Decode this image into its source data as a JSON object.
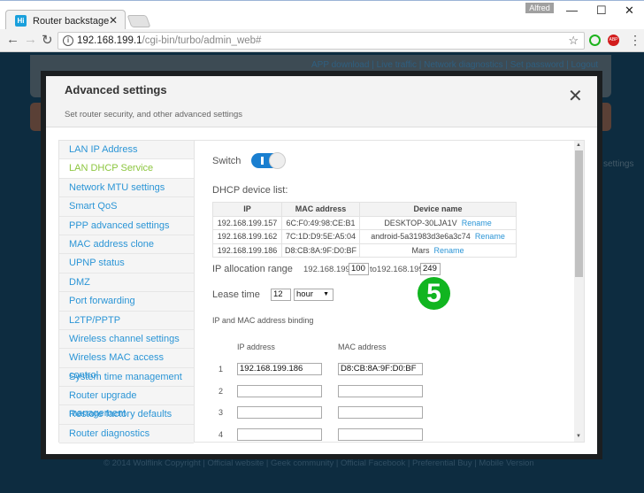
{
  "browser": {
    "tab_title": "Router backstage",
    "user": "Alfred",
    "url_host": "192.168.199.1",
    "url_path": "/cgi-bin/turbo/admin_web#"
  },
  "background": {
    "top_links": "APP download  |  Live traffic  |  Network diagnostics  |  Set password  |  Logout",
    "side_text": "settings",
    "footer": "© 2014 Wolflink Copyright  |  Official website  |  Geek community  |  Official Facebook  |  Preferential Buy  |  Mobile Version"
  },
  "modal": {
    "title": "Advanced settings",
    "subtitle": "Set router security, and other advanced settings",
    "sidebar": [
      "LAN IP Address",
      "LAN DHCP Service",
      "Network MTU settings",
      "Smart QoS",
      "PPP advanced settings",
      "MAC address clone",
      "UPNP status",
      "DMZ",
      "Port forwarding",
      "L2TP/PPTP",
      "Wireless channel settings",
      "Wireless MAC access control",
      "System time management",
      "Router upgrade management",
      "Restore factory defaults",
      "Router diagnostics"
    ],
    "active_item": "LAN DHCP Service",
    "content": {
      "switch_label": "Switch",
      "switch_on": true,
      "device_list_label": "DHCP device list:",
      "columns": [
        "IP",
        "MAC address",
        "Device name"
      ],
      "devices": [
        {
          "ip": "192.168.199.157",
          "mac": "6C:F0:49:98:CE:B1",
          "name": "DESKTOP-30LJA1V",
          "action": "Rename"
        },
        {
          "ip": "192.168.199.162",
          "mac": "7C:1D:D9:5E:A5:04",
          "name": "android-5a31983d3e6a3c74",
          "action": "Rename"
        },
        {
          "ip": "192.168.199.186",
          "mac": "D8:CB:8A:9F:D0:BF",
          "name": "Mars",
          "action": "Rename"
        }
      ],
      "range_label": "IP allocation range",
      "range_prefix": "192.168.199.",
      "range_start": "100",
      "range_to": "to192.168.199.",
      "range_end": "249",
      "lease_label": "Lease time",
      "lease_value": "12",
      "lease_unit": "hour",
      "binding_label": "IP and MAC address binding",
      "binding_ip_header": "IP address",
      "binding_mac_header": "MAC address",
      "bindings": [
        {
          "n": "1",
          "ip": "192.168.199.186",
          "mac": "D8:CB:8A:9F:D0:BF"
        },
        {
          "n": "2",
          "ip": "",
          "mac": ""
        },
        {
          "n": "3",
          "ip": "",
          "mac": ""
        },
        {
          "n": "4",
          "ip": "",
          "mac": ""
        }
      ]
    }
  },
  "step_badge": "5",
  "colors": {
    "accent": "#2b95d6",
    "active": "#8cc63f",
    "toggle": "#1a7fd0",
    "badge": "#11b520"
  }
}
